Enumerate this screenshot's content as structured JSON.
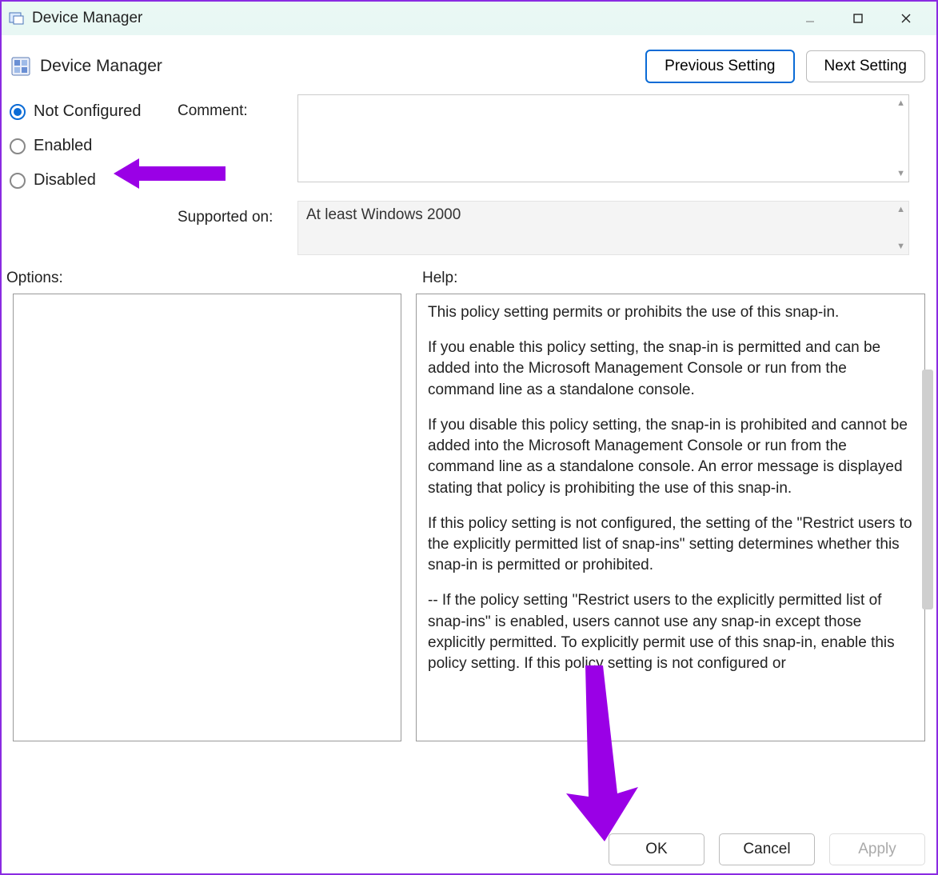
{
  "window": {
    "title": "Device Manager"
  },
  "policy": {
    "name": "Device Manager",
    "prev_label": "Previous Setting",
    "next_label": "Next Setting"
  },
  "state": {
    "not_configured": "Not Configured",
    "enabled": "Enabled",
    "disabled": "Disabled",
    "selected": "not_configured"
  },
  "labels": {
    "comment": "Comment:",
    "supported": "Supported on:",
    "options": "Options:",
    "help": "Help:"
  },
  "supported_text": "At least Windows 2000",
  "help_paragraphs": [
    "This policy setting permits or prohibits the use of this snap-in.",
    "If you enable this policy setting, the snap-in is permitted and can be added into the Microsoft Management Console or run from the command line as a standalone console.",
    "If you disable this policy setting, the snap-in is prohibited and cannot be added into the Microsoft Management Console or run from the command line as a standalone console. An error message is displayed stating that policy is prohibiting the use of this snap-in.",
    "If this policy setting is not configured, the setting of the \"Restrict users to the explicitly permitted list of snap-ins\" setting determines whether this snap-in is permitted or prohibited.",
    "--  If the policy setting \"Restrict users to the explicitly permitted list of snap-ins\" is enabled, users cannot use any snap-in except those explicitly permitted. To explicitly permit use of this snap-in, enable this policy setting. If this policy setting is not configured or"
  ],
  "footer": {
    "ok": "OK",
    "cancel": "Cancel",
    "apply": "Apply"
  }
}
